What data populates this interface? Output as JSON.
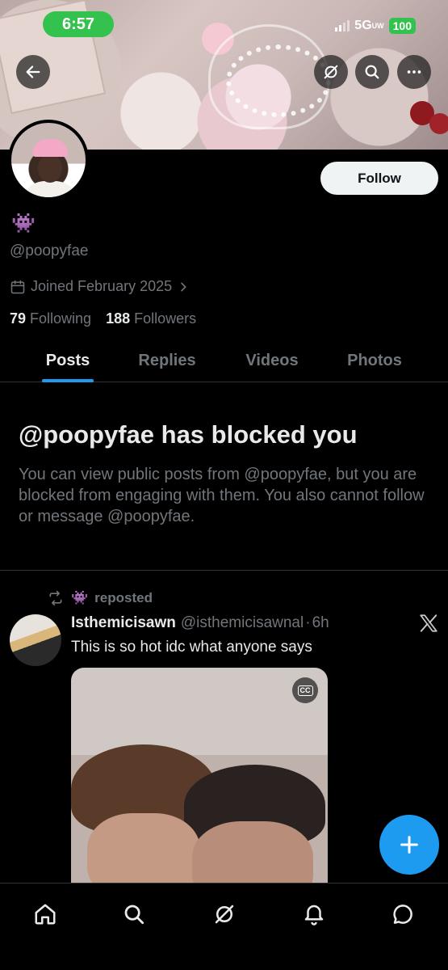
{
  "status_bar": {
    "time": "6:57",
    "network": "5G",
    "network_sub": "UW",
    "battery": "100"
  },
  "profile": {
    "display_name": "👾",
    "handle": "@poopyfae",
    "joined": "Joined February 2025",
    "following_count": "79",
    "following_label": "Following",
    "followers_count": "188",
    "followers_label": "Followers",
    "follow_button": "Follow"
  },
  "tabs": [
    {
      "label": "Posts",
      "active": true
    },
    {
      "label": "Replies",
      "active": false
    },
    {
      "label": "Videos",
      "active": false
    },
    {
      "label": "Photos",
      "active": false
    }
  ],
  "blocked_notice": {
    "title": "@poopyfae has blocked you",
    "description": "You can view public posts from @poopyfae, but you are blocked from engaging with them. You also cannot follow or message @poopyfae."
  },
  "tweet": {
    "repost_emoji": "👾",
    "repost_label": "reposted",
    "author_name": "Isthemicisawn",
    "author_handle": "@isthemicisawnal",
    "separator": "·",
    "time": "6h",
    "text": "This is so hot idc what anyone says",
    "media_badge": "CC"
  },
  "colors": {
    "accent": "#1d9bf0",
    "muted": "#71767b",
    "text": "#e7e9ea",
    "background": "#000000",
    "status_green": "#32c24d"
  },
  "icons": [
    "back-arrow-icon",
    "grok-icon",
    "search-icon",
    "more-icon",
    "calendar-icon",
    "chevron-right-icon",
    "repost-icon",
    "x-logo-icon",
    "closed-captions-icon",
    "plus-icon",
    "home-icon",
    "search-icon",
    "grok-icon",
    "bell-icon",
    "messages-icon"
  ]
}
